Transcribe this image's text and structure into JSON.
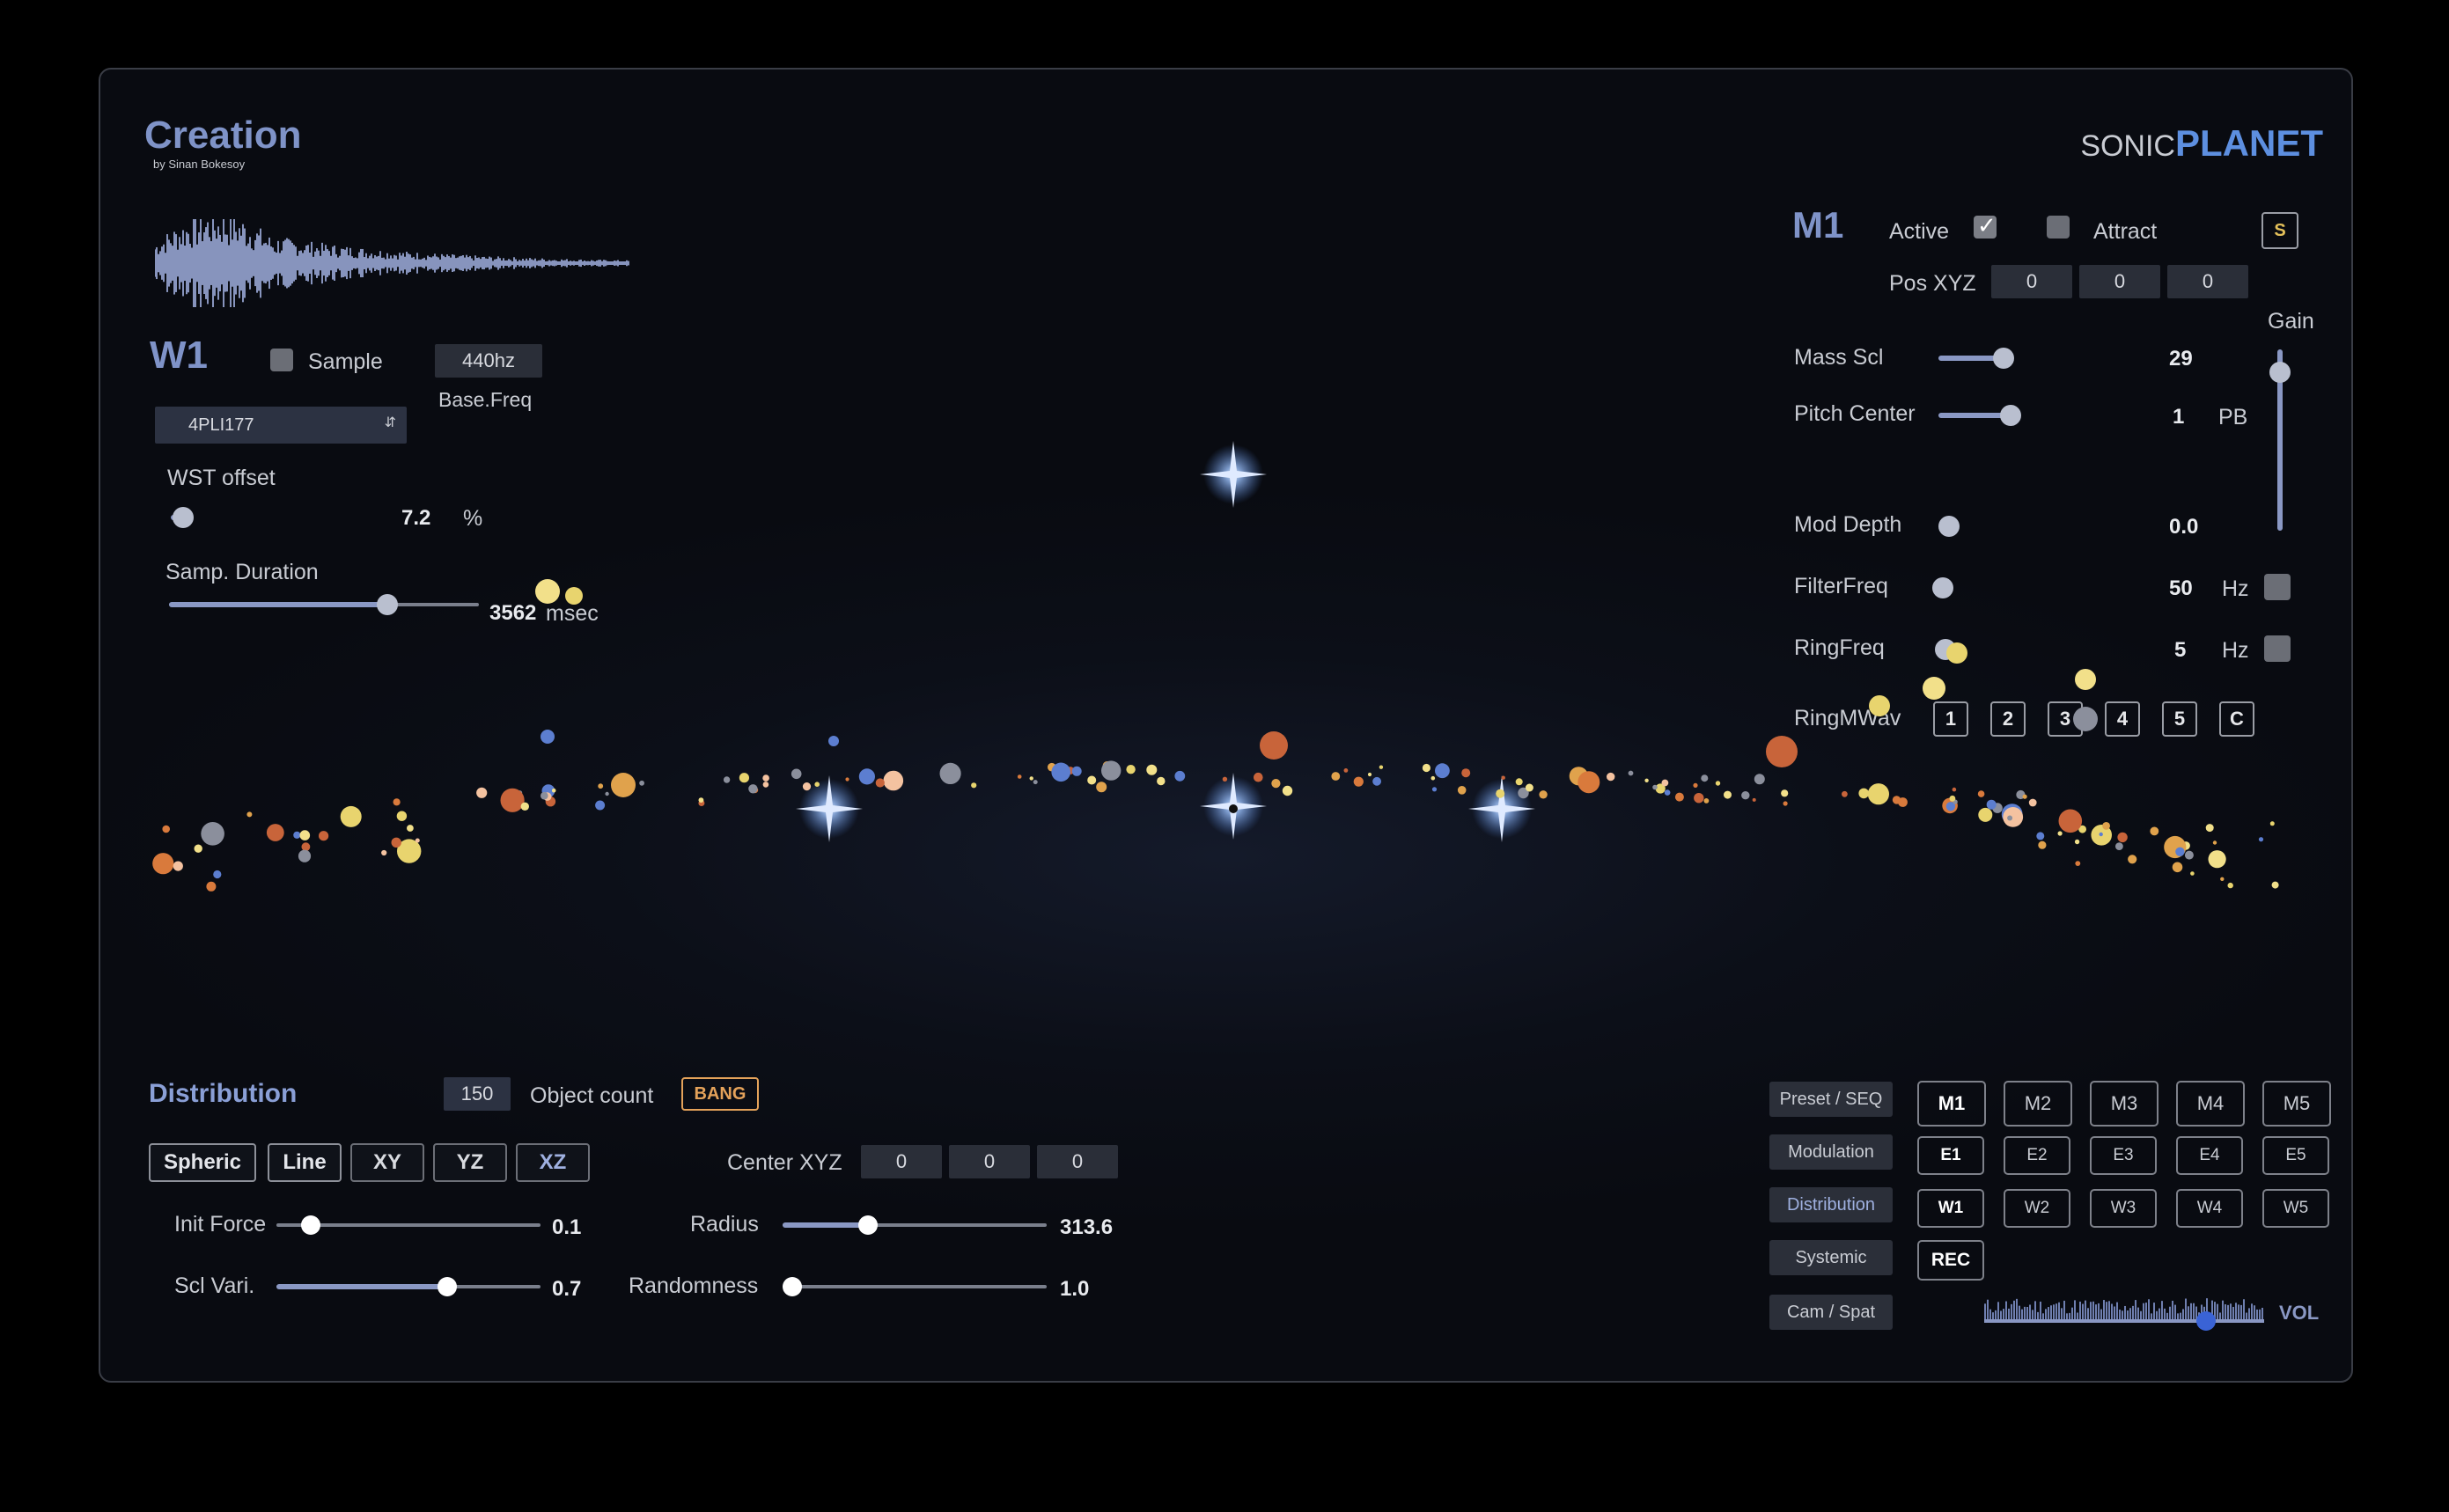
{
  "app": {
    "title": "Creation",
    "subtitle": "by Sinan Bokesoy",
    "brand_left": "SONIC",
    "brand_right": "PLANET"
  },
  "wave": {
    "name": "W1",
    "sample_label": "Sample",
    "freq_value": "440hz",
    "freq_label": "Base.Freq",
    "preset": "4PLI177",
    "wst_label": "WST offset",
    "wst_value": "7.2",
    "wst_unit": "%",
    "wst_level": 0.05,
    "dur_label": "Samp. Duration",
    "dur_value": "3562",
    "dur_unit": "msec",
    "dur_level": 0.7
  },
  "mass": {
    "name": "M1",
    "active_label": "Active",
    "attract_label": "Attract",
    "s_label": "S",
    "pos_label": "Pos XYZ",
    "pos": [
      "0",
      "0",
      "0"
    ],
    "gain_label": "Gain",
    "gain_level": 0.85,
    "mass_label": "Mass Scl",
    "mass_value": "29",
    "pitch_label": "Pitch Center",
    "pitch_value": "1",
    "pitch_unit": "PB",
    "mod_label": "Mod Depth",
    "mod_value": "0.0",
    "filter_label": "FilterFreq",
    "filter_value": "50",
    "filter_unit": "Hz",
    "ring_label": "RingFreq",
    "ring_value": "5",
    "ring_unit": "Hz",
    "ringwav_label": "RingMWav",
    "ringwav": [
      "1",
      "2",
      "3",
      "4",
      "5",
      "C"
    ]
  },
  "distribution": {
    "title": "Distribution",
    "count_value": "150",
    "count_label": "Object count",
    "bang_label": "BANG",
    "shapes": [
      "Spheric",
      "Line",
      "XY",
      "YZ",
      "XZ"
    ],
    "center_label": "Center XYZ",
    "center": [
      "0",
      "0",
      "0"
    ],
    "init_label": "Init Force",
    "init_value": "0.1",
    "init_level": 0.1,
    "radius_label": "Radius",
    "radius_value": "313.6",
    "radius_level": 0.31,
    "scl_label": "Scl Vari.",
    "scl_value": "0.7",
    "scl_level": 0.66,
    "rand_label": "Randomness",
    "rand_value": "1.0",
    "rand_level": 0.0
  },
  "nav": {
    "preset": "Preset / SEQ",
    "modulation": "Modulation",
    "distribution": "Distribution",
    "systemic": "Systemic",
    "cam": "Cam / Spat",
    "m_row": [
      "M1",
      "M2",
      "M3",
      "M4",
      "M5"
    ],
    "e_row": [
      "E1",
      "E2",
      "E3",
      "E4",
      "E5"
    ],
    "w_row": [
      "W1",
      "W2",
      "W3",
      "W4",
      "W5"
    ],
    "rec": "REC",
    "vol": "VOL"
  },
  "colors": {
    "accent": "#7f93c8",
    "bang": "#e4a25a"
  }
}
